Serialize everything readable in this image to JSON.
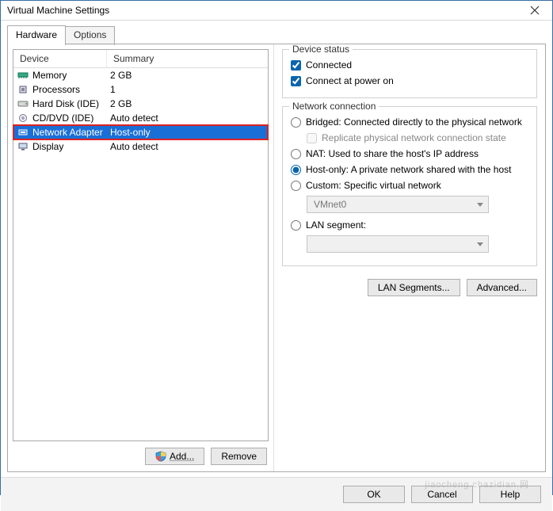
{
  "title": "Virtual Machine Settings",
  "tabs": {
    "hardware": "Hardware",
    "options": "Options"
  },
  "list": {
    "headers": {
      "device": "Device",
      "summary": "Summary"
    },
    "rows": [
      {
        "device": "Memory",
        "summary": "2 GB",
        "icon": "memory"
      },
      {
        "device": "Processors",
        "summary": "1",
        "icon": "cpu"
      },
      {
        "device": "Hard Disk (IDE)",
        "summary": "2 GB",
        "icon": "hdd"
      },
      {
        "device": "CD/DVD (IDE)",
        "summary": "Auto detect",
        "icon": "cd"
      },
      {
        "device": "Network Adapter",
        "summary": "Host-only",
        "icon": "net"
      },
      {
        "device": "Display",
        "summary": "Auto detect",
        "icon": "display"
      }
    ],
    "selected_index": 4,
    "add_label": "Add...",
    "remove_label": "Remove"
  },
  "status": {
    "group": "Device status",
    "connected": "Connected",
    "connect_at_power_on": "Connect at power on"
  },
  "network": {
    "group": "Network connection",
    "bridged": "Bridged: Connected directly to the physical network",
    "replicate": "Replicate physical network connection state",
    "nat": "NAT: Used to share the host's IP address",
    "hostonly": "Host-only: A private network shared with the host",
    "custom": "Custom: Specific virtual network",
    "custom_value": "VMnet0",
    "lan_segment": "LAN segment:",
    "lan_value": ""
  },
  "right_buttons": {
    "lan_segments": "LAN Segments...",
    "advanced": "Advanced..."
  },
  "dialog": {
    "ok": "OK",
    "cancel": "Cancel",
    "help": "Help"
  }
}
